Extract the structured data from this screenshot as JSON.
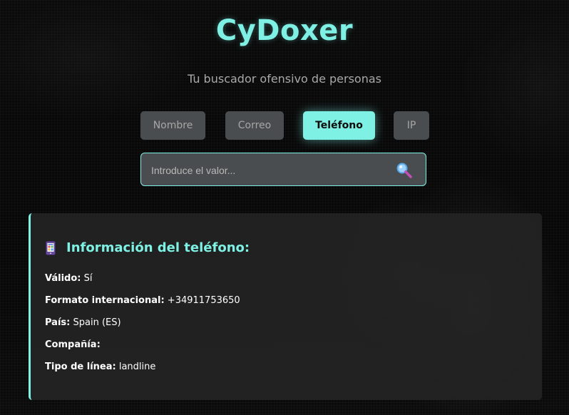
{
  "header": {
    "title": "CyDoxer",
    "subtitle": "Tu buscador ofensivo de personas"
  },
  "tabs": [
    {
      "label": "Nombre",
      "active": false
    },
    {
      "label": "Correo",
      "active": false
    },
    {
      "label": "Teléfono",
      "active": true
    },
    {
      "label": "IP",
      "active": false
    }
  ],
  "search": {
    "placeholder": "Introduce el valor...",
    "value": "",
    "button_icon": "magnifier-icon"
  },
  "result": {
    "icon": "mobile-phone-icon",
    "title": "Información del teléfono:",
    "rows": [
      {
        "key": "Válido:",
        "value": "Sí"
      },
      {
        "key": "Formato internacional:",
        "value": "+34911753650"
      },
      {
        "key": "País:",
        "value": "Spain (ES)"
      },
      {
        "key": "Compañía:",
        "value": ""
      },
      {
        "key": "Tipo de línea:",
        "value": "landline"
      }
    ]
  },
  "colors": {
    "accent": "#7ef0e4",
    "tab_inactive": "#4a4d4f",
    "card_bg": "#242424"
  }
}
